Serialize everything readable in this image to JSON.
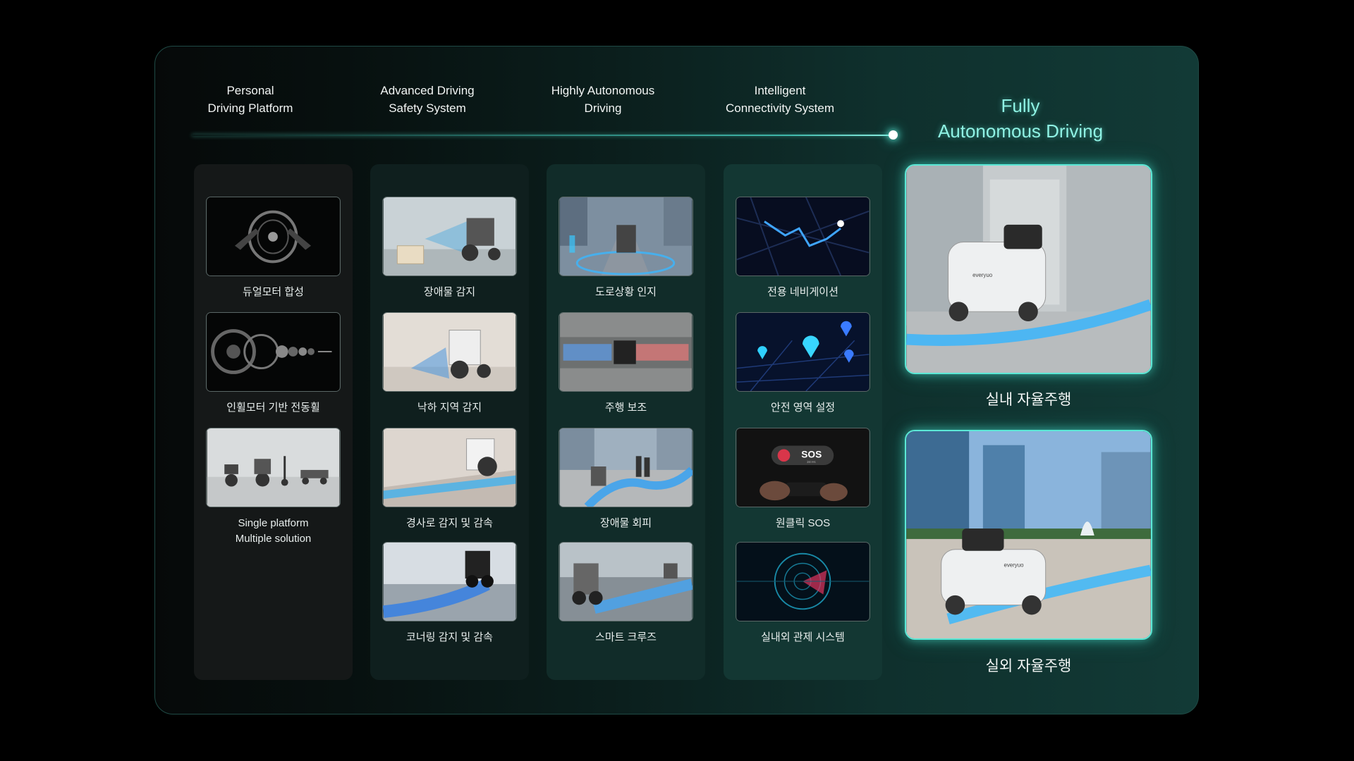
{
  "stages": [
    {
      "line1": "Personal",
      "line2": "Driving Platform"
    },
    {
      "line1": "Advanced Driving",
      "line2": "Safety System"
    },
    {
      "line1": "Highly Autonomous",
      "line2": "Driving"
    },
    {
      "line1": "Intelligent",
      "line2": "Connectivity System"
    }
  ],
  "final": {
    "line1": "Fully",
    "line2": "Autonomous Driving"
  },
  "columns": [
    {
      "items": [
        {
          "label": "듀얼모터 합성",
          "icon": "dual-motor-wheel"
        },
        {
          "label": "인휠모터 기반 전동휠",
          "icon": "in-wheel-motor-exploded"
        },
        {
          "label": "Single platform",
          "label2": "Multiple solution",
          "icon": "vehicle-lineup"
        }
      ]
    },
    {
      "items": [
        {
          "label": "장애물 감지",
          "icon": "obstacle-detection"
        },
        {
          "label": "낙하 지역 감지",
          "icon": "drop-zone-detection"
        },
        {
          "label": "경사로 감지 및 감속",
          "icon": "slope-detection"
        },
        {
          "label": "코너링 감지 및 감속",
          "icon": "cornering-detection"
        }
      ]
    },
    {
      "items": [
        {
          "label": "도로상황 인지",
          "icon": "road-recognition"
        },
        {
          "label": "주행 보조",
          "icon": "driving-assist"
        },
        {
          "label": "장애물 회피",
          "icon": "obstacle-avoidance"
        },
        {
          "label": "스마트 크루즈",
          "icon": "smart-cruise"
        }
      ]
    },
    {
      "items": [
        {
          "label": "전용 네비게이션",
          "icon": "navigation-map"
        },
        {
          "label": "안전 영역 설정",
          "icon": "safe-zone-pins"
        },
        {
          "label": "원클릭 SOS",
          "icon": "sos-phone",
          "sos_text": "SOS",
          "sos_sub": "24 Hr."
        },
        {
          "label": "실내외 관제 시스템",
          "icon": "radar-monitor"
        }
      ]
    }
  ],
  "final_items": [
    {
      "label": "실내 자율주행",
      "icon": "indoor-autonomous",
      "brand": "everyuo"
    },
    {
      "label": "실외 자율주행",
      "icon": "outdoor-autonomous",
      "brand": "everyuo"
    }
  ],
  "colors": {
    "accent": "#5ce8d6",
    "title_accent": "#8ff2e4",
    "panel_border": "#1f4a45"
  }
}
